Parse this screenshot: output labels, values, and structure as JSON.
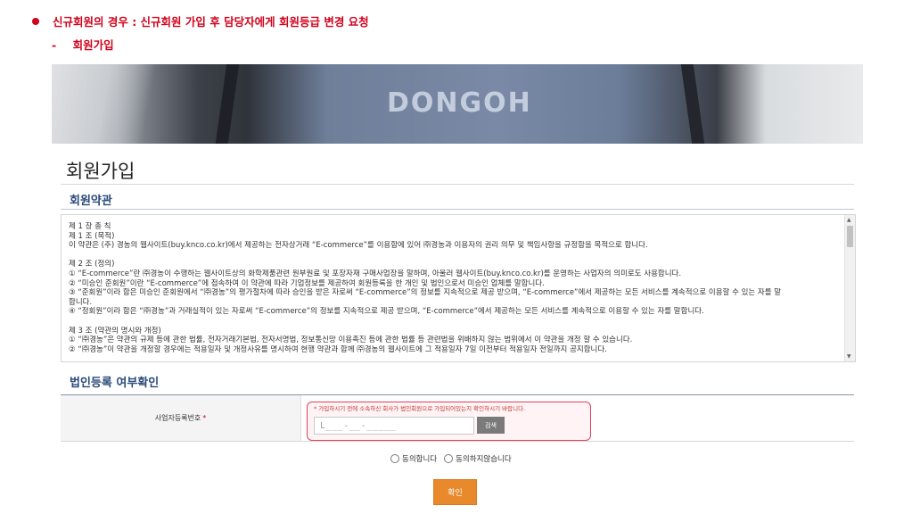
{
  "notice": {
    "bullet_text": "신규회원의 경우 : 신규회원 가입 후 담당자에게 회원등급 변경 요청",
    "sub_dash": "-",
    "sub_text": "회원가입"
  },
  "banner": {
    "logo_text": "DONGOH"
  },
  "page": {
    "title": "회원가입"
  },
  "terms_section": {
    "title": "회원약관",
    "lines": [
      "제 1 장 총 칙",
      "제 1 조 (목적)",
      "이 약관은 (주) 경농의 웹사이트(buy.knco.co.kr)에서 제공하는 전자상거래 “E-commerce”를 이용함에 있어 ㈜경농과 이용자의 권리 의무 및 책임사항을 규정함을 목적으로 합니다.",
      "",
      "제 2 조 (정의)",
      "① “E-commerce”란 ㈜경농이 수행하는 웹사이트상의 화학제품관련 원부원료 및 포장자재 구매사업장을 말하며, 아울러 웹사이트(buy.knco.co.kr)를 운영하는 사업자의 의미로도 사용합니다.",
      "② “미승인 준회원”이란 “E-commerce”에 접속하여 이 약관에 따라 기업정보를 제공하여 회원등록을 한 개인 및 법인으로서 미승인 업체를 말합니다.",
      "③ “준회원”이라 함은 미승인 준회원에서 “㈜경농”의 평가절차에 따라 승인을 받은 자로써 “E-commerce”의 정보를 지속적으로 제공 받으며, “E-commerce”에서 제공하는 모든 서비스를 계속적으로 이용할 수 있는 자를 말",
      "합니다.",
      "④ “정회원”이라 함은 “㈜경농”과 거래실적이 있는 자로써 “E-commerce”의 정보를 지속적으로 제공 받으며, “E-commerce”에서 제공하는 모든 서비스를 계속적으로 이용할 수 있는 자를 말합니다.",
      "",
      "제 3 조 (약관의 명시와 개정)",
      "① “㈜경농”은 약관의 규제 등에 관한 법률, 전자거래기본법, 전자서명법, 정보통신망 이용촉진 등에 관한 법률 등 관련법을 위배하지 않는 범위에서 이 약관을 개정 할 수 있습니다.",
      "② “㈜경농”이 약관을 개정할 경우에는 적용일자 및 개정사유를 명시하여 현행 약관과 함께 ㈜경농의 웹사이트에 그 적용일자 7일 이전부터 적용일자 전일까지 공지합니다."
    ]
  },
  "registration": {
    "title": "법인등록 여부확인",
    "field_label": "사업자등록번호",
    "required_mark": "*",
    "hint": "* 가입하시기 전에 소속하신 회사가 법인회원으로 가입되어있는지 확인하시기 바랍니다.",
    "brn_value": "L___-__-_____",
    "search_label": "검색"
  },
  "agreement": {
    "agree_label": "동의합니다",
    "disagree_label": "동의하지않습니다"
  },
  "confirm_label": "확인",
  "colors": {
    "notice_red": "#d0021b",
    "section_blue": "#2a4a7a",
    "confirm_orange": "#e8892b"
  }
}
